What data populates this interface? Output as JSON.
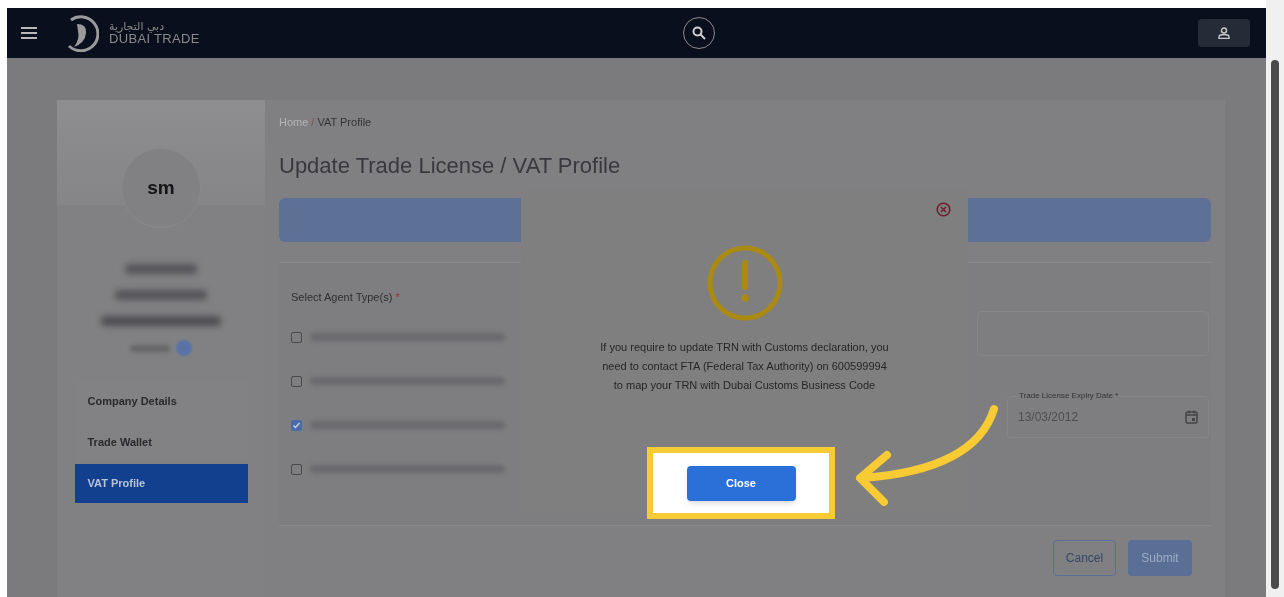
{
  "header": {
    "logo_arabic": "دبي التجارية",
    "logo_text": "DUBAI TRADE"
  },
  "profile": {
    "initials": "sm"
  },
  "sidebar": {
    "items": [
      {
        "label": "Company Details",
        "selected": false
      },
      {
        "label": "Trade Wallet",
        "selected": false
      },
      {
        "label": "VAT Profile",
        "selected": true
      }
    ]
  },
  "breadcrumb": {
    "items": [
      "Home",
      "VAT Profile"
    ],
    "separator": "/"
  },
  "page_title": "Update Trade License / VAT Profile",
  "form": {
    "agent_type_label": "Select Agent Type(s)",
    "required_mark": "*",
    "agent_types": [
      {
        "checked": false
      },
      {
        "checked": false
      },
      {
        "checked": true
      },
      {
        "checked": false
      }
    ],
    "expiry_date": {
      "label": "Trade License Expiry Date *",
      "value": "13/03/2012"
    }
  },
  "buttons": [
    {
      "label": "Cancel",
      "kind": "outline"
    },
    {
      "label": "Submit",
      "kind": "primary"
    }
  ],
  "dialog": {
    "message": "If you require to update TRN with Customs declaration, you need to contact FTA (Federal Tax Authority) on 600599994 to map your TRN with Dubai Customs Business Code",
    "button": "Close"
  }
}
